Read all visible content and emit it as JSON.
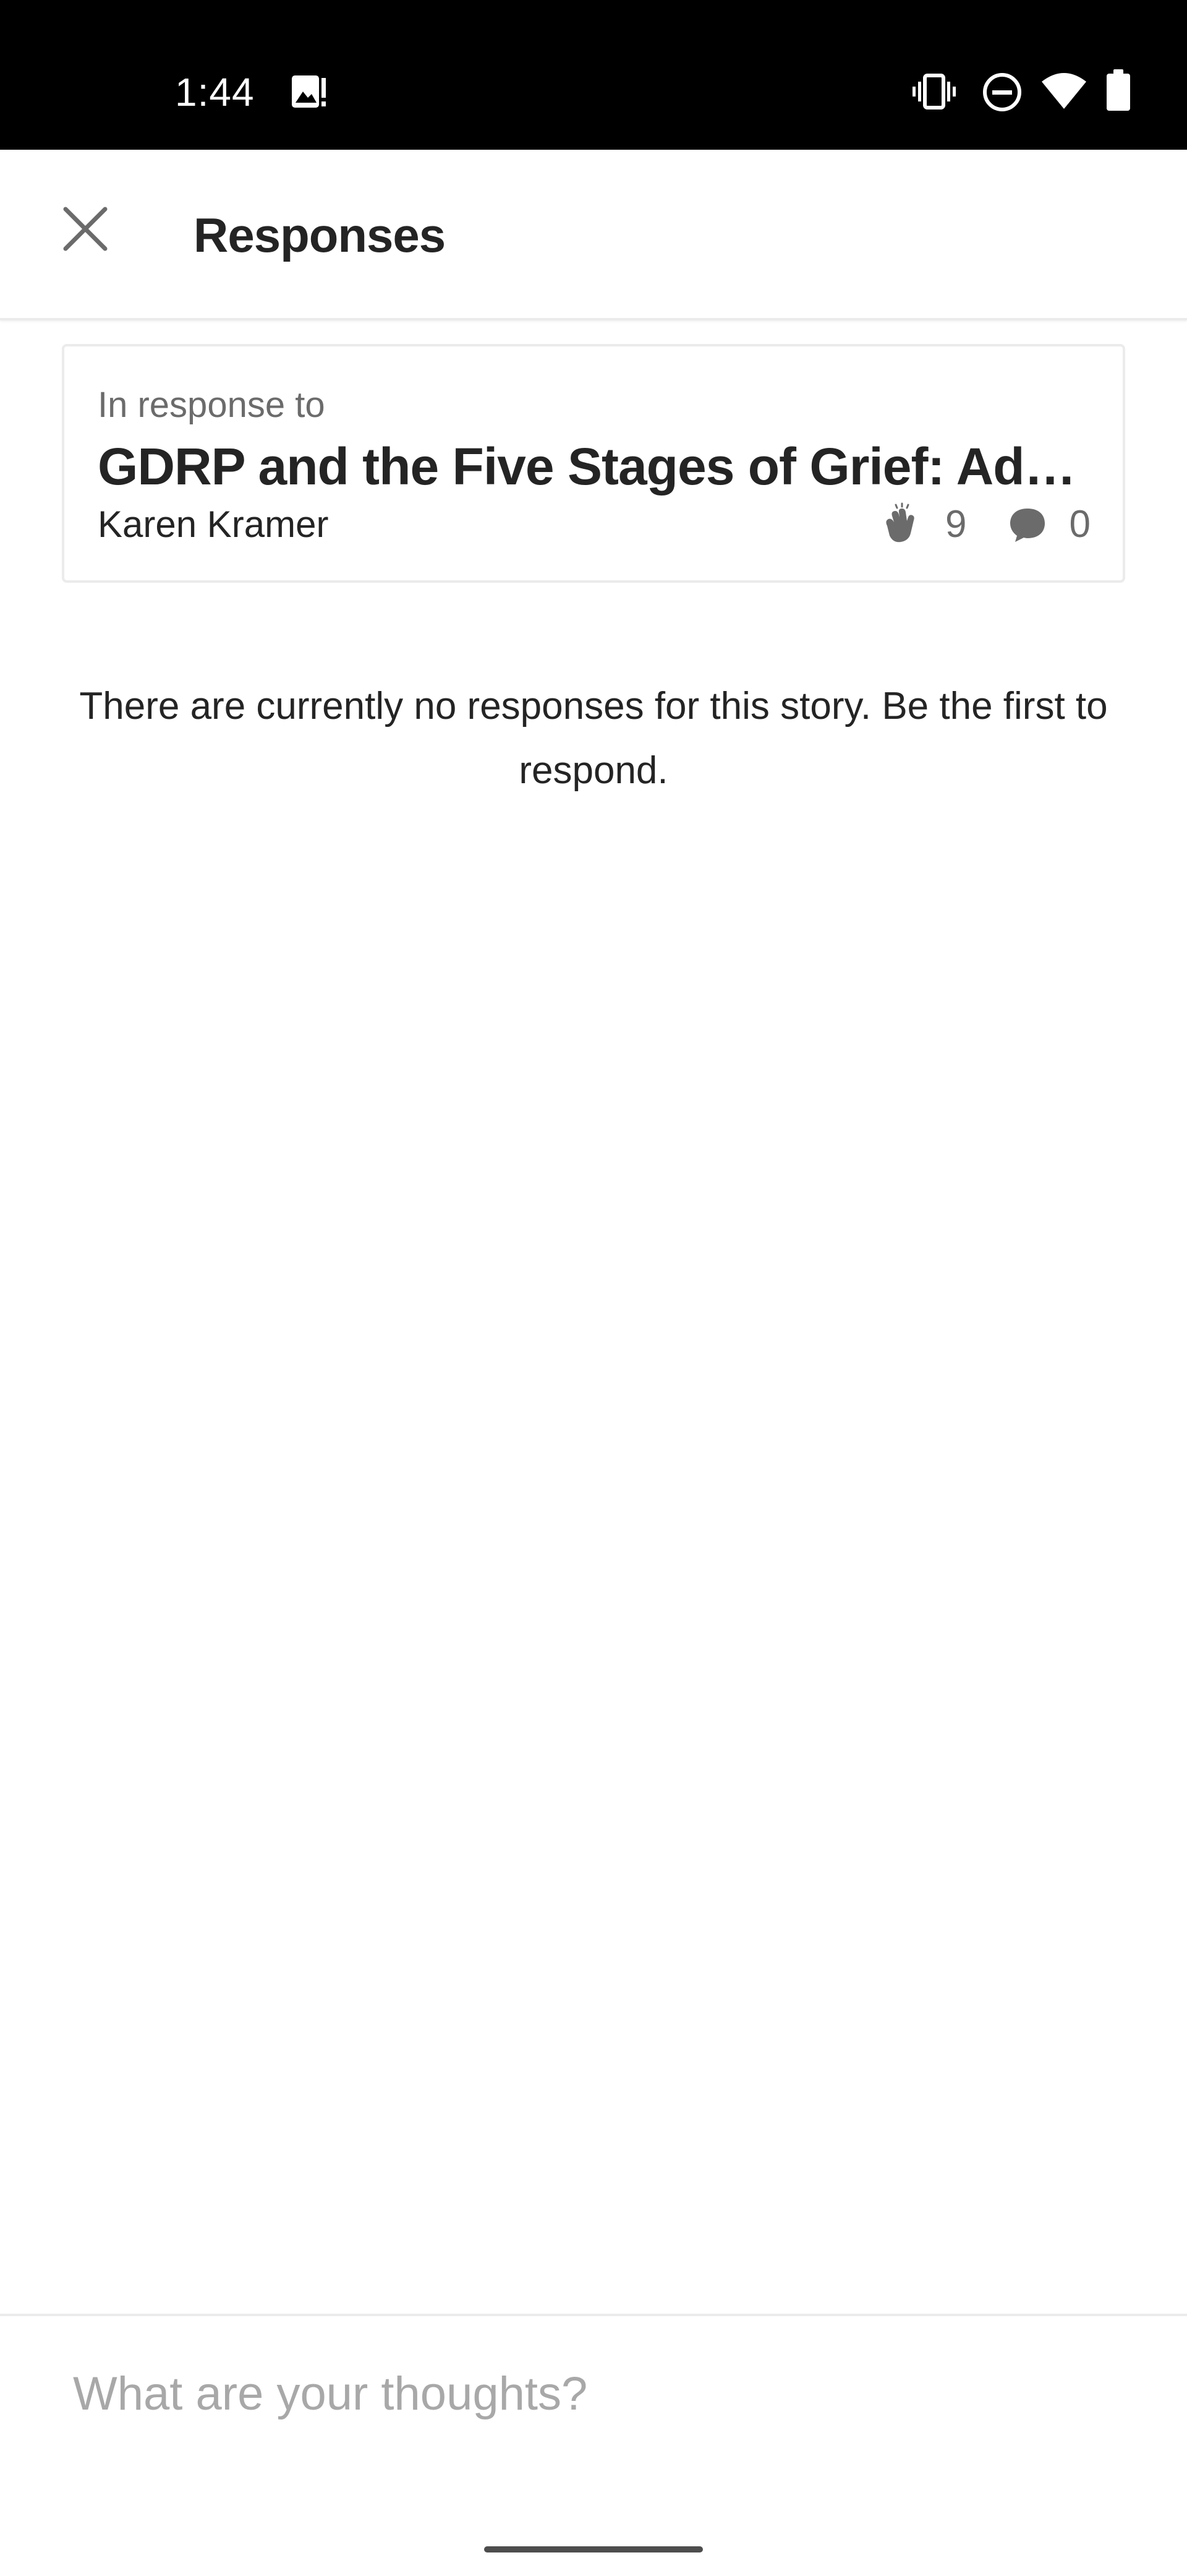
{
  "status_bar": {
    "time": "1:44",
    "notification_icon": "image-alert-icon",
    "right_icons": [
      "vibrate-icon",
      "do-not-disturb-icon",
      "wifi-icon",
      "battery-icon"
    ]
  },
  "app_bar": {
    "title": "Responses",
    "close_icon": "close-icon"
  },
  "story_card": {
    "kicker": "In response to",
    "title": "GDRP and the Five Stages of Grief: Adapting to New Privacy Regulations",
    "author": "Karen Kramer",
    "claps": "9",
    "responses": "0"
  },
  "empty_state": {
    "message": "There are currently no responses for this story. Be the first to respond."
  },
  "composer": {
    "placeholder": "What are your thoughts?",
    "value": ""
  },
  "colors": {
    "text_primary": "#242424",
    "text_secondary": "#6b6b6b",
    "placeholder": "#a8a8a8",
    "divider": "#ebebeb",
    "status_bar_bg": "#000000"
  }
}
